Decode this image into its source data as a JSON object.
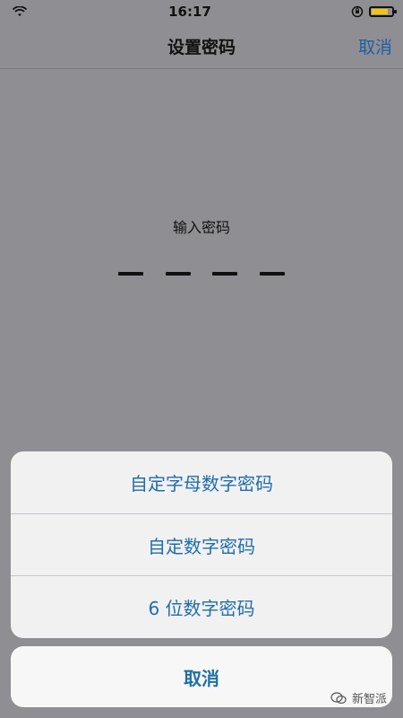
{
  "status": {
    "time": "16:17",
    "icons": [
      "wifi-icon",
      "orientation-lock-icon",
      "battery-icon"
    ],
    "battery_level": 0.8,
    "battery_color": "#f1c40f"
  },
  "nav": {
    "title": "设置密码",
    "cancel_label": "取消"
  },
  "passcode": {
    "prompt": "输入密码",
    "digits_total": 4,
    "digits_entered": 0,
    "hidden_option_label": "密码选项"
  },
  "action_sheet": {
    "options": [
      {
        "label": "自定字母数字密码"
      },
      {
        "label": "自定数字密码"
      },
      {
        "label": "6 位数字密码"
      }
    ],
    "cancel_label": "取消",
    "accent_color": "#1f6ea8"
  },
  "watermark": {
    "text": "新智派",
    "icon": "wechat-icon"
  }
}
